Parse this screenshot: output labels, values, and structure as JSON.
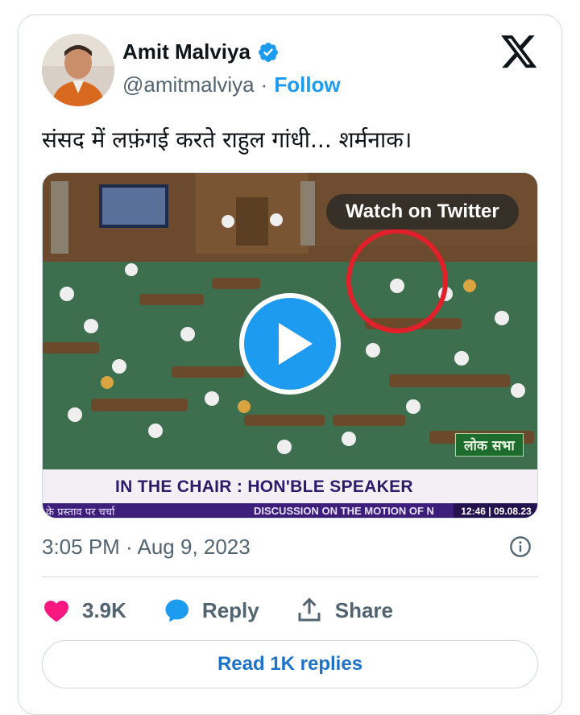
{
  "author": {
    "name": "Amit Malviya",
    "handle": "@amitmalviya",
    "separator": "·",
    "follow_label": "Follow",
    "verified_icon": "verified-badge-icon"
  },
  "platform_icon": "x-logo-icon",
  "tweet": {
    "text": "संसद में लफ़ंगई करते राहुल गांधी... शर्मनाक।"
  },
  "media": {
    "watch_label": "Watch on Twitter",
    "ticker": "IN THE CHAIR : HON'BLE SPEAKER",
    "subticker_left": "के प्रस्ताव पर चर्चा",
    "subticker_mid": "DISCUSSION ON THE MOTION OF N",
    "subticker_time": "12:46 | 09.08.23",
    "channel_label": "लोक सभा",
    "play_icon": "play-icon"
  },
  "timestamp": "3:05 PM · Aug 9, 2023",
  "actions": {
    "like_count": "3.9K",
    "reply_label": "Reply",
    "share_label": "Share"
  },
  "read_replies_label": "Read 1K replies",
  "colors": {
    "accent": "#1d9bf0",
    "like": "#f91880",
    "text_secondary": "#536471"
  }
}
